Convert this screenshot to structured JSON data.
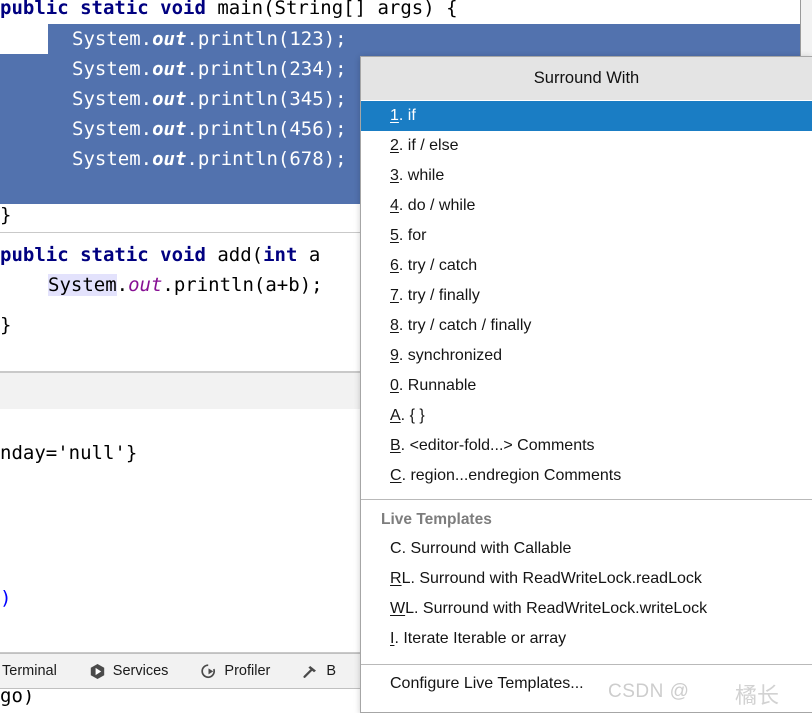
{
  "editor": {
    "lines": [
      {
        "segments": [
          {
            "t": "public static void ",
            "c": "kw"
          },
          {
            "t": "main(",
            "c": ""
          },
          {
            "t": "String",
            "c": ""
          },
          {
            "t": "[] args) {",
            "c": ""
          }
        ]
      },
      {
        "segments": [
          {
            "t": "        System.out.println(123);",
            "c": ""
          }
        ]
      },
      {
        "segments": [
          {
            "t": "        System.out.println(234);",
            "c": ""
          }
        ]
      },
      {
        "segments": [
          {
            "t": "        System.out.println(345);",
            "c": ""
          }
        ]
      },
      {
        "segments": [
          {
            "t": "        System.out.println(456);",
            "c": ""
          }
        ]
      },
      {
        "segments": [
          {
            "t": "        System.out.println(678);",
            "c": ""
          }
        ]
      },
      {
        "segments": [
          {
            "t": "}",
            "c": ""
          }
        ]
      },
      {
        "segments": [
          {
            "t": "public static void ",
            "c": "kw"
          },
          {
            "t": "add(",
            "c": ""
          },
          {
            "t": "int",
            "c": "kw"
          },
          {
            "t": " a",
            "c": ""
          }
        ]
      },
      {
        "segments": [
          {
            "t": "        System.out.println(a+b);",
            "c": ""
          }
        ]
      },
      {
        "segments": [
          {
            "t": "}",
            "c": ""
          }
        ]
      }
    ],
    "code_text": {
      "line1_kw": "public static void ",
      "line1_rest": "main(String[] args) {",
      "print123": "System.out.println(123);",
      "print234": "System.out.println(234);",
      "print345": "System.out.println(345);",
      "print456": "System.out.println(456);",
      "print678": "System.out.println(678);",
      "brace_close_1": "}",
      "line_add_kw": "public static void ",
      "line_add_name": "add(",
      "line_add_int": "int",
      "line_add_param": " a",
      "print_ab": "System.out.println(a+b);",
      "brace_close_2": "}",
      "system_token": "System",
      "dot": ".",
      "out_token": "out",
      "println_123": ".println(123);",
      "println_234": ".println(234);",
      "println_345": ".println(345);",
      "println_456": ".println(456);",
      "println_678": ".println(678);",
      "println_ab": ".println(a+b);"
    },
    "colors": {
      "selection": "#5272ae",
      "keyword": "#000080",
      "field": "#871094",
      "identifier_highlight": "#e3e2fc"
    }
  },
  "console": {
    "line_1": "nday='null'}",
    "line_2": ")",
    "tail_line": "go)"
  },
  "popup": {
    "title": "Surround With",
    "items": [
      {
        "mnemonic": "1",
        "label": "if",
        "selected": true
      },
      {
        "mnemonic": "2",
        "label": "if / else",
        "selected": false
      },
      {
        "mnemonic": "3",
        "label": "while",
        "selected": false
      },
      {
        "mnemonic": "4",
        "label": "do / while",
        "selected": false
      },
      {
        "mnemonic": "5",
        "label": "for",
        "selected": false
      },
      {
        "mnemonic": "6",
        "label": "try / catch",
        "selected": false
      },
      {
        "mnemonic": "7",
        "label": "try / finally",
        "selected": false
      },
      {
        "mnemonic": "8",
        "label": "try / catch / finally",
        "selected": false
      },
      {
        "mnemonic": "9",
        "label": "synchronized",
        "selected": false
      },
      {
        "mnemonic": "0",
        "label": "Runnable",
        "selected": false
      },
      {
        "mnemonic": "A",
        "label": "{ }",
        "selected": false
      },
      {
        "mnemonic": "B",
        "label": "<editor-fold...> Comments",
        "selected": false
      },
      {
        "mnemonic": "C",
        "label": "region...endregion Comments",
        "selected": false
      }
    ],
    "group_title": "Live Templates",
    "templates": [
      {
        "mnemonic": "C ",
        "mnemonic_underlined": false,
        "label": "Surround with Callable"
      },
      {
        "mnemonic": "R",
        "mnemonic_underlined": true,
        "suffix": "L",
        "label": "Surround with ReadWriteLock.readLock"
      },
      {
        "mnemonic": "W",
        "mnemonic_underlined": true,
        "suffix": "L",
        "label": "Surround with ReadWriteLock.writeLock"
      },
      {
        "mnemonic": "I",
        "mnemonic_underlined": true,
        "suffix": "",
        "label": "Iterate Iterable or array"
      }
    ],
    "footer": "Configure Live Templates...",
    "colors": {
      "selected_background": "#1a7dc4",
      "header_background": "#e4e4e4",
      "group_title": "#7d7d7d"
    }
  },
  "bottom_toolbar": {
    "items": [
      {
        "label": "Terminal",
        "icon": ""
      },
      {
        "label": "Services",
        "icon": "services-icon"
      },
      {
        "label": "Profiler",
        "icon": "profiler-icon"
      },
      {
        "label": "B",
        "icon": "build-hammer-icon"
      }
    ]
  },
  "watermark": {
    "text": "CSDN @",
    "author": "橘长"
  }
}
